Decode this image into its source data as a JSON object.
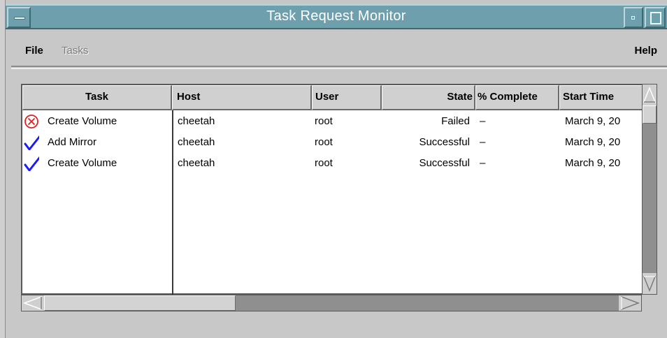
{
  "window": {
    "title": "Task Request Monitor"
  },
  "menubar": {
    "file_label": "File",
    "tasks_label": "Tasks",
    "help_label": "Help"
  },
  "table": {
    "columns": [
      "Task",
      "Host",
      "User",
      "State",
      "% Complete",
      "Start Time"
    ],
    "rows": [
      {
        "icon": "failed-icon",
        "task": "Create Volume",
        "host": "cheetah",
        "user": "root",
        "state": "Failed",
        "complete": "–",
        "start": "March 9, 20"
      },
      {
        "icon": "success-check-icon",
        "task": "Add Mirror",
        "host": "cheetah",
        "user": "root",
        "state": "Successful",
        "complete": "–",
        "start": "March 9, 20"
      },
      {
        "icon": "success-check-icon",
        "task": "Create Volume",
        "host": "cheetah",
        "user": "root",
        "state": "Successful",
        "complete": "–",
        "start": "March 9, 20"
      }
    ]
  },
  "colors": {
    "titlebar": "#6d9fad",
    "failed_icon": "#e02020",
    "success_icon": "#1a1aff"
  }
}
